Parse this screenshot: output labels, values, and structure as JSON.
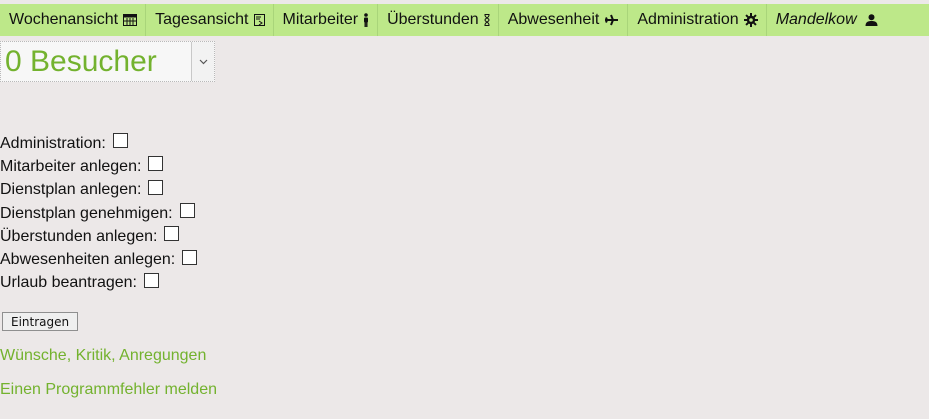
{
  "nav": {
    "items": [
      {
        "label": "Wochenansicht",
        "icon": "calendar-icon"
      },
      {
        "label": "Tagesansicht",
        "icon": "day-view-icon"
      },
      {
        "label": "Mitarbeiter",
        "icon": "person-icon"
      },
      {
        "label": "Überstunden",
        "icon": "hourglass-icon"
      },
      {
        "label": "Abwesenheit",
        "icon": "plane-icon"
      },
      {
        "label": "Administration",
        "icon": "gear-icon"
      }
    ],
    "user": {
      "label": "Mandelkow",
      "icon": "user-icon"
    }
  },
  "visitor_select": {
    "value": "0 Besucher"
  },
  "permissions": [
    {
      "label": "Administration:"
    },
    {
      "label": "Mitarbeiter anlegen:"
    },
    {
      "label": "Dienstplan anlegen:"
    },
    {
      "label": "Dienstplan genehmigen:"
    },
    {
      "label": "Überstunden anlegen:"
    },
    {
      "label": "Abwesenheiten anlegen:"
    },
    {
      "label": "Urlaub beantragen:"
    }
  ],
  "submit_label": "Eintragen",
  "links": {
    "feedback": "Wünsche, Kritik, Anregungen",
    "bug_report": "Einen Programmfehler melden"
  },
  "colors": {
    "nav_background": "#bde889",
    "link_green": "#73b22e",
    "page_background": "#ece8e8"
  }
}
